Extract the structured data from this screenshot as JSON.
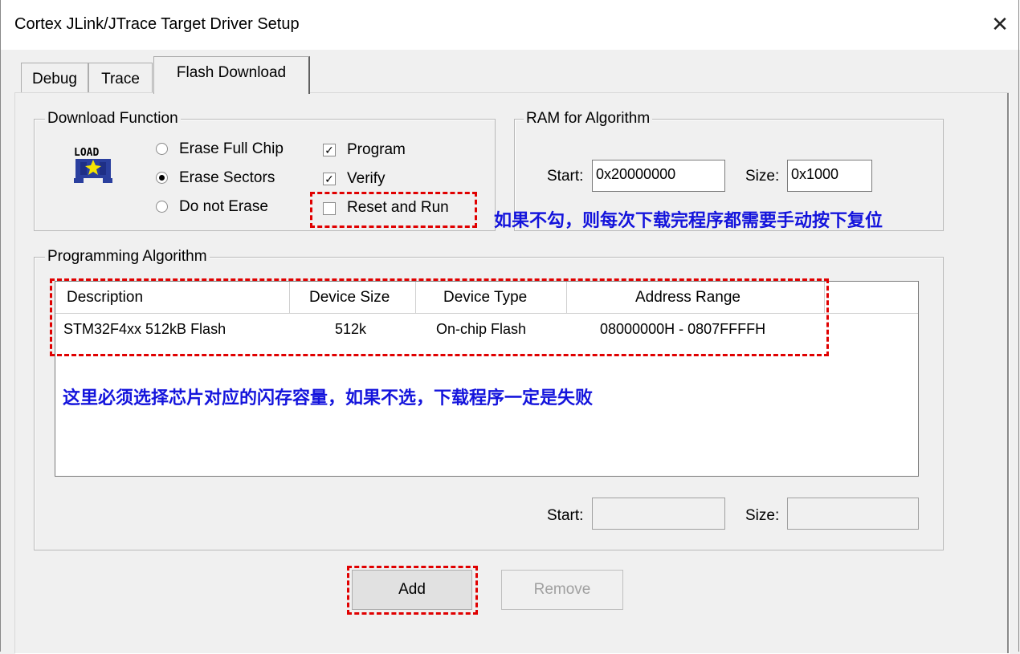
{
  "window": {
    "title": "Cortex JLink/JTrace Target Driver Setup",
    "close_symbol": "✕"
  },
  "tabs": [
    {
      "label": "Debug",
      "active": false
    },
    {
      "label": "Trace",
      "active": false
    },
    {
      "label": "Flash Download",
      "active": true
    }
  ],
  "download_function": {
    "title": "Download Function",
    "icon_label": "LOAD",
    "options": [
      {
        "label": "Erase Full Chip",
        "selected": false
      },
      {
        "label": "Erase Sectors",
        "selected": true
      },
      {
        "label": "Do not Erase",
        "selected": false
      }
    ],
    "checks": [
      {
        "label": "Program",
        "checked": true
      },
      {
        "label": "Verify",
        "checked": true
      },
      {
        "label": "Reset and Run",
        "checked": false
      }
    ]
  },
  "ram_for_algorithm": {
    "title": "RAM for Algorithm",
    "start_label": "Start:",
    "start_value": "0x20000000",
    "size_label": "Size:",
    "size_value": "0x1000"
  },
  "programming_algorithm": {
    "title": "Programming Algorithm",
    "columns": [
      "Description",
      "Device Size",
      "Device Type",
      "Address Range"
    ],
    "rows": [
      {
        "description": "STM32F4xx 512kB Flash",
        "device_size": "512k",
        "device_type": "On-chip Flash",
        "address_range": "08000000H - 0807FFFFH"
      }
    ],
    "start_label": "Start:",
    "start_value": "",
    "size_label": "Size:",
    "size_value": ""
  },
  "buttons": {
    "add": "Add",
    "remove": "Remove"
  },
  "annotations": {
    "reset_note": "如果不勾，则每次下载完程序都需要手动按下复位",
    "algorithm_note": "这里必须选择芯片对应的闪存容量，如果不选，下载程序一定是失败"
  },
  "colors": {
    "annotation_text": "#1414dc",
    "dashed_highlight": "#e00000"
  }
}
